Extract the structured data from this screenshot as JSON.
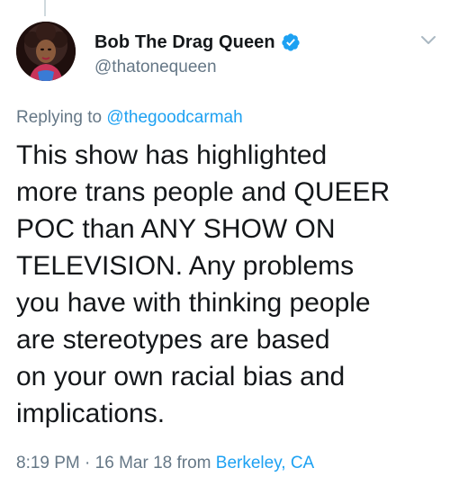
{
  "tweet": {
    "author": {
      "display_name": "Bob The Drag Queen",
      "handle": "@thatonequeen",
      "verified": true,
      "avatar_icon": "profile-photo"
    },
    "reply": {
      "prefix": "Replying to",
      "mention": "@thegoodcarmah"
    },
    "body": "This show has highlighted\nmore trans people and QUEER\nPOC than ANY SHOW ON\nTELEVISION. Any problems\nyou have with thinking people\nare stereotypes are based\non your own racial bias and\nimplications.",
    "meta": {
      "time": "8:19 PM",
      "separator": "·",
      "date": "16 Mar 18",
      "from_label": "from",
      "location": "Berkeley, CA"
    }
  },
  "icons": {
    "verified": "verified-badge-icon",
    "menu": "chevron-down-icon"
  },
  "colors": {
    "text": "#14171a",
    "secondary": "#657786",
    "link": "#1da1f2",
    "badge": "#1da1f2"
  }
}
